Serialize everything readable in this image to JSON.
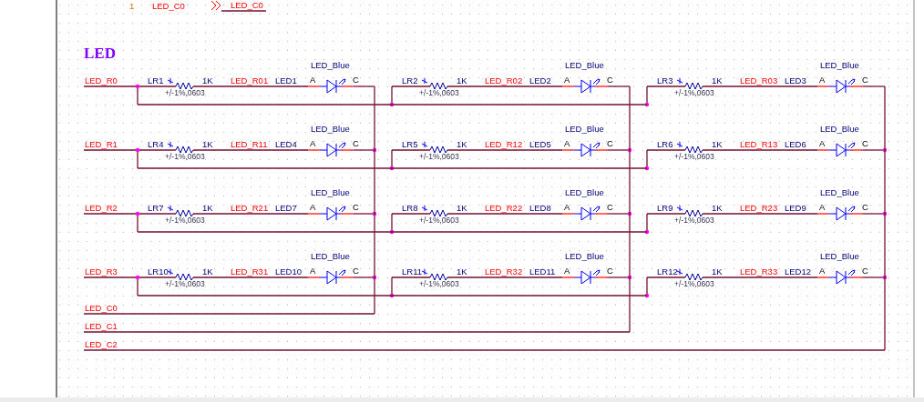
{
  "top_fragment": {
    "pin_number": "1",
    "pin_net": "LED_C0",
    "port_net": "LED_C0"
  },
  "sheet_title": "LED",
  "row_nets": [
    "LED_R0",
    "LED_R1",
    "LED_R2",
    "LED_R3"
  ],
  "column_nets": [
    "LED_C0",
    "LED_C1",
    "LED_C2"
  ],
  "cells": [
    [
      {
        "resistor": "LR1",
        "value": "1K",
        "tolerance": "+/-1%,0603",
        "net": "LED_R01",
        "led": "LED1",
        "led_value": "LED_Blue",
        "anode": "A",
        "cathode": "C"
      },
      {
        "resistor": "LR2",
        "value": "1K",
        "tolerance": "+/-1%,0603",
        "net": "LED_R02",
        "led": "LED2",
        "led_value": "LED_Blue",
        "anode": "A",
        "cathode": "C"
      },
      {
        "resistor": "LR3",
        "value": "1K",
        "tolerance": "+/-1%,0603",
        "net": "LED_R03",
        "led": "LED3",
        "led_value": "LED_Blue",
        "anode": "A",
        "cathode": "C"
      }
    ],
    [
      {
        "resistor": "LR4",
        "value": "1K",
        "tolerance": "+/-1%,0603",
        "net": "LED_R11",
        "led": "LED4",
        "led_value": "LED_Blue",
        "anode": "A",
        "cathode": "C"
      },
      {
        "resistor": "LR5",
        "value": "1K",
        "tolerance": "+/-1%,0603",
        "net": "LED_R12",
        "led": "LED5",
        "led_value": "LED_Blue",
        "anode": "A",
        "cathode": "C"
      },
      {
        "resistor": "LR6",
        "value": "1K",
        "tolerance": "+/-1%,0603",
        "net": "LED_R13",
        "led": "LED6",
        "led_value": "LED_Blue",
        "anode": "A",
        "cathode": "C"
      }
    ],
    [
      {
        "resistor": "LR7",
        "value": "1K",
        "tolerance": "+/-1%,0603",
        "net": "LED_R21",
        "led": "LED7",
        "led_value": "LED_Blue",
        "anode": "A",
        "cathode": "C"
      },
      {
        "resistor": "LR8",
        "value": "1K",
        "tolerance": "+/-1%,0603",
        "net": "LED_R22",
        "led": "LED8",
        "led_value": "LED_Blue",
        "anode": "A",
        "cathode": "C"
      },
      {
        "resistor": "LR9",
        "value": "1K",
        "tolerance": "+/-1%,0603",
        "net": "LED_R23",
        "led": "LED9",
        "led_value": "LED_Blue",
        "anode": "A",
        "cathode": "C"
      }
    ],
    [
      {
        "resistor": "LR10",
        "value": "1K",
        "tolerance": "+/-1%,0603",
        "net": "LED_R31",
        "led": "LED10",
        "led_value": "LED_Blue",
        "anode": "A",
        "cathode": "C"
      },
      {
        "resistor": "LR11",
        "value": "1K",
        "tolerance": "+/-1%,0603",
        "net": "LED_R32",
        "led": "LED11",
        "led_value": "LED_Blue",
        "anode": "A",
        "cathode": "C"
      },
      {
        "resistor": "LR12",
        "value": "1K",
        "tolerance": "+/-1%,0603",
        "net": "LED_R33",
        "led": "LED12",
        "led_value": "LED_Blue",
        "anode": "A",
        "cathode": "C"
      }
    ]
  ]
}
